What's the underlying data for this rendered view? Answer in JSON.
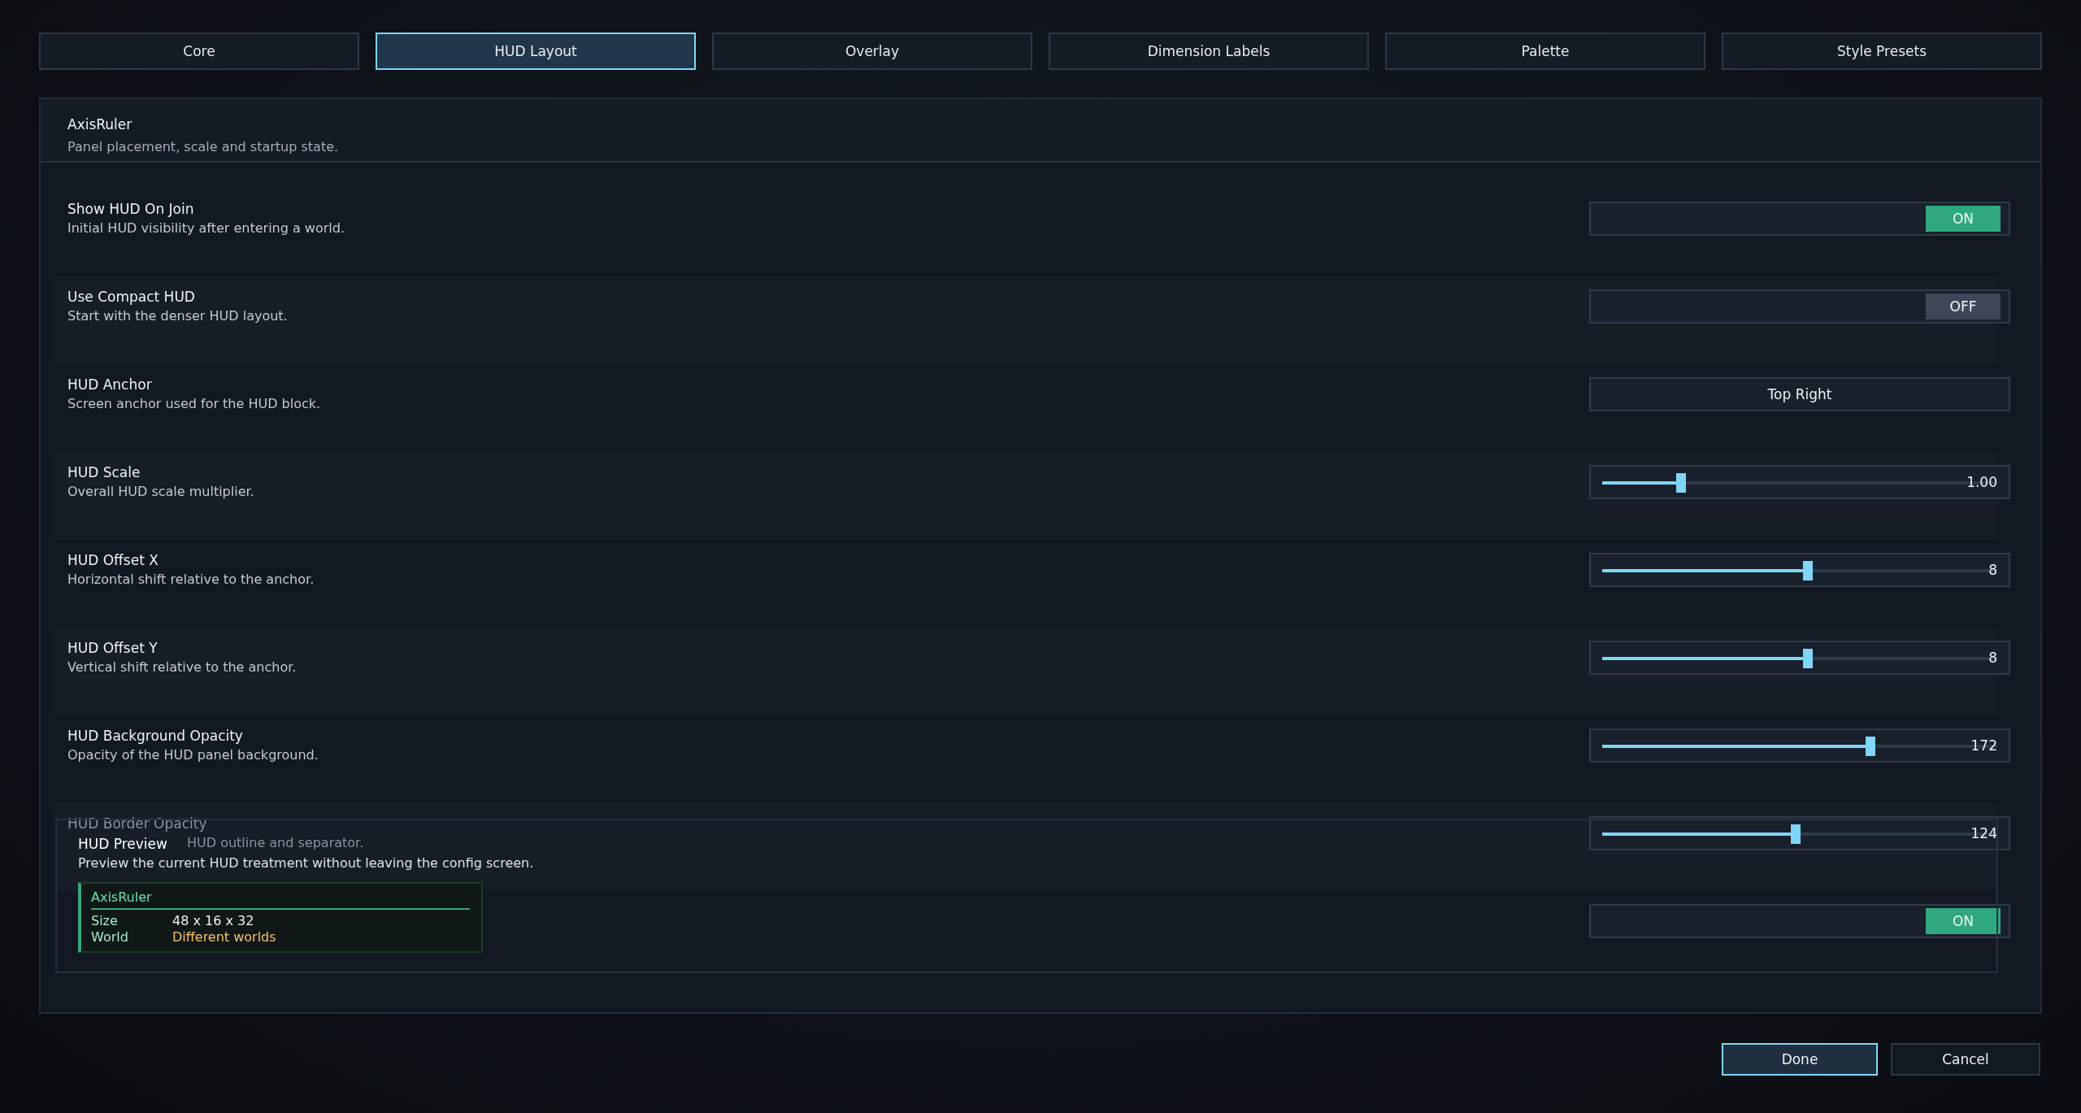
{
  "tabs": [
    {
      "label": "Core",
      "selected": false
    },
    {
      "label": "HUD Layout",
      "selected": true
    },
    {
      "label": "Overlay",
      "selected": false
    },
    {
      "label": "Dimension Labels",
      "selected": false
    },
    {
      "label": "Palette",
      "selected": false
    },
    {
      "label": "Style Presets",
      "selected": false
    }
  ],
  "section": {
    "title": "AxisRuler",
    "description": "Panel placement, scale and startup state."
  },
  "rows": [
    {
      "title": "Show HUD On Join",
      "description": "Initial HUD visibility after entering a world.",
      "obscured": false,
      "control": {
        "kind": "toggle",
        "on": true,
        "label": "ON"
      }
    },
    {
      "title": "Use Compact HUD",
      "description": "Start with the denser HUD layout.",
      "obscured": false,
      "control": {
        "kind": "toggle",
        "on": false,
        "label": "OFF"
      }
    },
    {
      "title": "HUD Anchor",
      "description": "Screen anchor used for the HUD block.",
      "obscured": false,
      "control": {
        "kind": "cycle",
        "value": "Top Right"
      }
    },
    {
      "title": "HUD Scale",
      "description": "Overall HUD scale multiplier.",
      "obscured": false,
      "control": {
        "kind": "slider",
        "level": 0.2,
        "value": "1.00"
      }
    },
    {
      "title": "HUD Offset X",
      "description": "Horizontal shift relative to the anchor.",
      "obscured": false,
      "control": {
        "kind": "slider",
        "level": 0.52,
        "value": "8"
      }
    },
    {
      "title": "HUD Offset Y",
      "description": "Vertical shift relative to the anchor.",
      "obscured": false,
      "control": {
        "kind": "slider",
        "level": 0.52,
        "value": "8"
      }
    },
    {
      "title": "HUD Background Opacity",
      "description": "Opacity of the HUD panel background.",
      "obscured": false,
      "control": {
        "kind": "slider",
        "level": 0.68,
        "value": "172"
      }
    },
    {
      "title": "HUD Border Opacity",
      "description": "HUD outline and separator.",
      "obscured": true,
      "control": {
        "kind": "slider",
        "level": 0.49,
        "value": "124"
      }
    },
    {
      "control": {
        "kind": "toggle",
        "on": true,
        "label": "ON"
      }
    }
  ],
  "preview": {
    "title": "HUD Preview",
    "description": "Preview the current HUD treatment without leaving the config screen.",
    "card": {
      "title": "AxisRuler",
      "lines": [
        {
          "label": "Size",
          "value": "48 x 16 x 32",
          "color": "#f2f2f2"
        },
        {
          "label": "World",
          "value": "Different worlds",
          "color": "#f4c06a"
        }
      ]
    }
  },
  "buttons": [
    {
      "label": "Done",
      "selected": true
    },
    {
      "label": "Cancel",
      "selected": false
    }
  ]
}
